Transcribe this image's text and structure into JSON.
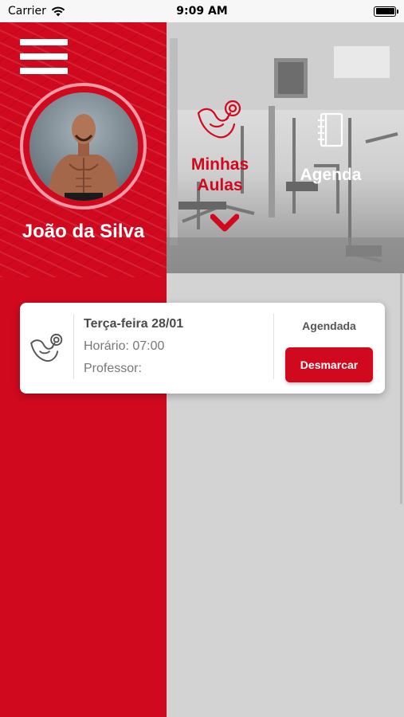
{
  "status_bar": {
    "carrier": "Carrier",
    "time": "9:09 AM"
  },
  "profile": {
    "name": "João da Silva"
  },
  "nav": {
    "minhas_aulas": {
      "line1": "Minhas",
      "line2": "Aulas",
      "icon": "dumbbell-arm-icon"
    },
    "agenda": {
      "label": "Agenda",
      "icon": "notebook-icon"
    }
  },
  "class_card": {
    "date": "Terça-feira 28/01",
    "time": "Horário: 07:00",
    "teacher": "Professor:",
    "status": "Agendada",
    "action_label": "Desmarcar",
    "icon": "dumbbell-arm-icon"
  },
  "colors": {
    "brand_red": "#d0091f",
    "ring_pink": "#f29aa6",
    "background_gray": "#d3d3d3"
  }
}
